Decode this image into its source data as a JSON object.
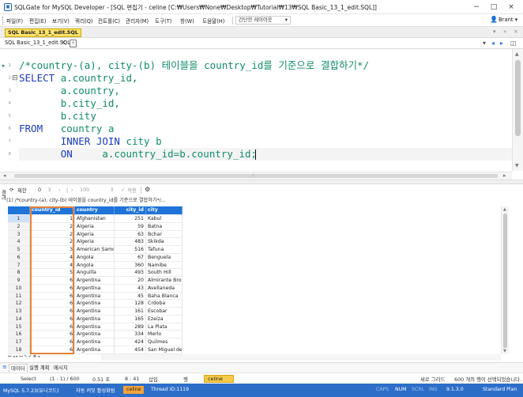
{
  "window": {
    "logo": "▣",
    "title": "SQLGate for MySQL Developer - [SQL 편집기 - celine [C:₩Users₩None₩Desktop₩Tutorial₩13₩SQL Basic_13_1_edit.SQL]]",
    "minimize": "−",
    "maximize": "□",
    "close": "×"
  },
  "menubar": {
    "items": [
      "파일(F)",
      "편집(E)",
      "보기(V)",
      "쿼리(Q)",
      "컨트롤(C)",
      "관리자(M)",
      "도구(T)",
      "창(W)",
      "도움말(H)"
    ],
    "layout_combo": "간단한 레이아웃",
    "combo_arrow": "▾",
    "user": "Brant ▾"
  },
  "docbar": {
    "doc_tab": "SQL Basic_13_1_edit.SQL",
    "controls": [
      "▾",
      "»",
      "×"
    ]
  },
  "tabbar": {
    "tab_label": "SQL Basic_13_1_edit.SQL",
    "close": "×",
    "new_icon": "+",
    "right_controls": [
      "▾",
      "◂",
      "▸",
      "◫"
    ]
  },
  "editor": {
    "lines": [
      {
        "num": "1",
        "fold": "",
        "mark": "▸",
        "segs": [
          [
            "cmt",
            "/*country-(a), city-(b) 테이블을 country_id를 기준으로 결합하기*/"
          ]
        ]
      },
      {
        "num": "2",
        "fold": "⊟",
        "mark": "",
        "segs": [
          [
            "kw",
            "SELECT "
          ],
          [
            "id",
            "a.country_id,"
          ]
        ]
      },
      {
        "num": "3",
        "fold": "",
        "mark": "",
        "segs": [
          [
            "sp",
            "       "
          ],
          [
            "id",
            "a.country,"
          ]
        ]
      },
      {
        "num": "4",
        "fold": "",
        "mark": "",
        "segs": [
          [
            "sp",
            "       "
          ],
          [
            "id",
            "b.city_id,"
          ]
        ]
      },
      {
        "num": "5",
        "fold": "",
        "mark": "",
        "segs": [
          [
            "sp",
            "       "
          ],
          [
            "id",
            "b.city"
          ]
        ]
      },
      {
        "num": "6",
        "fold": "",
        "mark": "",
        "segs": [
          [
            "kw",
            "FROM   "
          ],
          [
            "id",
            "country a"
          ]
        ]
      },
      {
        "num": "7",
        "fold": "",
        "mark": "",
        "segs": [
          [
            "sp",
            "       "
          ],
          [
            "kw",
            "INNER JOIN "
          ],
          [
            "id",
            "city b"
          ]
        ]
      },
      {
        "num": "8",
        "fold": "",
        "mark": "",
        "segs": [
          [
            "sp",
            "       "
          ],
          [
            "kw",
            "ON     "
          ],
          [
            "id",
            "a.country_id=b.country_id;"
          ]
        ]
      }
    ]
  },
  "result_panel": {
    "side_label": "결과",
    "toolbar": [
      "제한",
      "0",
      "⇕",
      "‹",
      "|",
      "›",
      "100",
      "⇕",
      "✓",
      "적용",
      "⚙"
    ],
    "query_text": "(1) /*country-(a), city-(b) 테이블을 country_id를 기준으로 결합하기*/...",
    "columns": [
      "",
      "country_id",
      "country",
      "city_id",
      "city"
    ],
    "rows": [
      [
        "1",
        "1",
        "Afghanistan",
        "251",
        "Kabul"
      ],
      [
        "2",
        "2",
        "Algeria",
        "59",
        "Batna"
      ],
      [
        "3",
        "2",
        "Algeria",
        "63",
        "Bchar"
      ],
      [
        "4",
        "2",
        "Algeria",
        "483",
        "Skikda"
      ],
      [
        "5",
        "3",
        "American Samoa",
        "516",
        "Tafuna"
      ],
      [
        "6",
        "4",
        "Angola",
        "67",
        "Benguela"
      ],
      [
        "7",
        "4",
        "Angola",
        "360",
        "Namibe"
      ],
      [
        "8",
        "5",
        "Anguilla",
        "493",
        "South Hill"
      ],
      [
        "9",
        "6",
        "Argentina",
        "20",
        "Almirante Brown"
      ],
      [
        "10",
        "6",
        "Argentina",
        "43",
        "Avellaneda"
      ],
      [
        "11",
        "6",
        "Argentina",
        "45",
        "Baha Blanca"
      ],
      [
        "12",
        "6",
        "Argentina",
        "128",
        "Crdoba"
      ],
      [
        "13",
        "6",
        "Argentina",
        "161",
        "Escobar"
      ],
      [
        "14",
        "6",
        "Argentina",
        "165",
        "Ezeiza"
      ],
      [
        "15",
        "6",
        "Argentina",
        "289",
        "La Plata"
      ],
      [
        "16",
        "6",
        "Argentina",
        "334",
        "Merlo"
      ],
      [
        "17",
        "6",
        "Argentina",
        "424",
        "Quilmes"
      ],
      [
        "18",
        "6",
        "Argentina",
        "454",
        "San Miguel de T"
      ]
    ],
    "nav": "⏮ ◂ ▸ ⏭ ✎ ✔ ✖ ◂"
  },
  "bottom_tabs": [
    "데이터",
    "실행 계획",
    "메시지"
  ],
  "bottom_tabs_icon": "≡",
  "status1": {
    "select": "Select",
    "rows": "(1 : 1) / 600",
    "time": "0.51 초",
    "pos": "8 : 41",
    "insert": "삽입",
    "mode": "행",
    "conn": "celine",
    "grid_mode": "세로 그리드",
    "selected": "600 개의 행이 선택되었습니다."
  },
  "status2": {
    "server": "MySQL 5.7.23(유니코드)",
    "autocommit": "자동 커밋 활성화됨",
    "conn": "celine",
    "thread": "Thread ID:1119",
    "caps": "CAPS",
    "num": "NUM",
    "scrl": "SCRL",
    "ins": "INS",
    "version": "9.1.3.0",
    "plan": "Standard Plan"
  },
  "colors": {
    "accent": "#1e74d8",
    "status_bar": "#2d6ec9",
    "highlight": "#f7c948",
    "selection_box": "#e9803a"
  }
}
